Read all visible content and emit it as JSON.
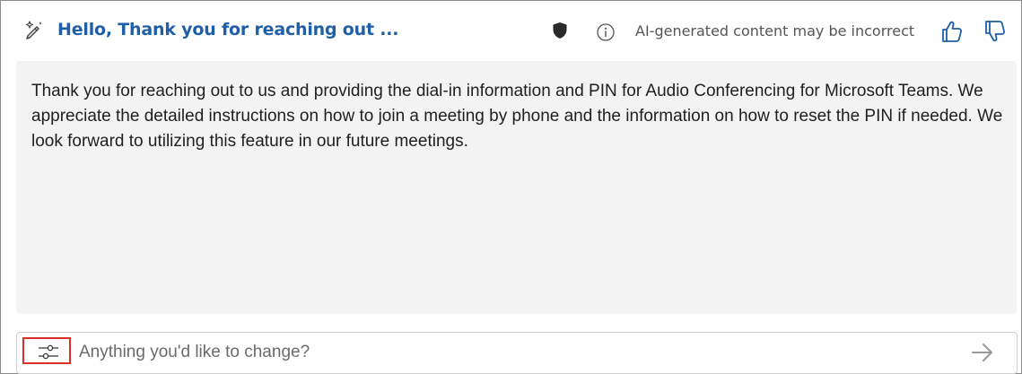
{
  "header": {
    "title": "Hello, Thank you for reaching out ...",
    "disclaimer": "AI-generated content may be incorrect",
    "icons": [
      "pen-sparkle-icon",
      "shield-icon",
      "info-icon",
      "thumbs-up-icon",
      "thumbs-down-icon"
    ]
  },
  "body": {
    "text": "Thank you for reaching out to us and providing the dial-in information and PIN for Audio Conferencing for Microsoft Teams. We appreciate the detailed instructions on how to join a meeting by phone and the information on how to reset the PIN if needed. We look forward to utilizing this feature in our future meetings."
  },
  "input": {
    "placeholder": "Anything you'd like to change?",
    "value": "",
    "icons": [
      "sliders-icon",
      "send-arrow-icon"
    ]
  },
  "colors": {
    "title": "#1f5fa8",
    "accent": "#1f5fa8",
    "panel_background": "#f3f3f3",
    "highlight_border": "#d9302a"
  }
}
